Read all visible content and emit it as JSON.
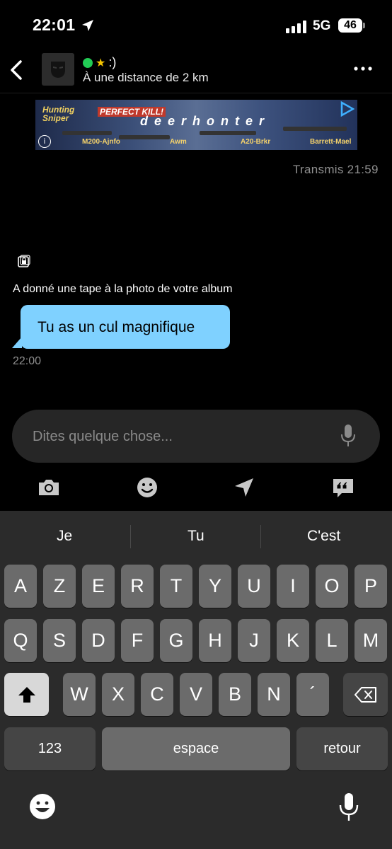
{
  "status_bar": {
    "time": "22:01",
    "network": "5G",
    "battery": "46"
  },
  "header": {
    "status_star": "★",
    "status_text": ":)",
    "distance": "À une distance de 2 km"
  },
  "ad": {
    "brand": "Hunting Sniper",
    "headline": "PERFECT KILL!",
    "title": "deerhonter",
    "weapon_labels": [
      "M200-Ajnfo",
      "Awm",
      "A20-Brkr",
      "Barrett-Mael"
    ]
  },
  "chat": {
    "sent_status": "Transmis 21:59",
    "system_event": "A donné une tape à la photo de votre album",
    "message_text": "Tu as un cul magnifique",
    "message_time": "22:00"
  },
  "composer": {
    "placeholder": "Dites quelque chose..."
  },
  "keyboard": {
    "suggestions": [
      "Je",
      "Tu",
      "C'est"
    ],
    "row1": [
      "A",
      "Z",
      "E",
      "R",
      "T",
      "Y",
      "U",
      "I",
      "O",
      "P"
    ],
    "row2": [
      "Q",
      "S",
      "D",
      "F",
      "G",
      "H",
      "J",
      "K",
      "L",
      "M"
    ],
    "row3": [
      "W",
      "X",
      "C",
      "V",
      "B",
      "N",
      "´"
    ],
    "numbers_label": "123",
    "space_label": "espace",
    "return_label": "retour"
  },
  "colors": {
    "bubble": "#7fd1ff",
    "online": "#22cc55",
    "star": "#f5c400",
    "keyboard_bg": "#2b2b2b"
  }
}
